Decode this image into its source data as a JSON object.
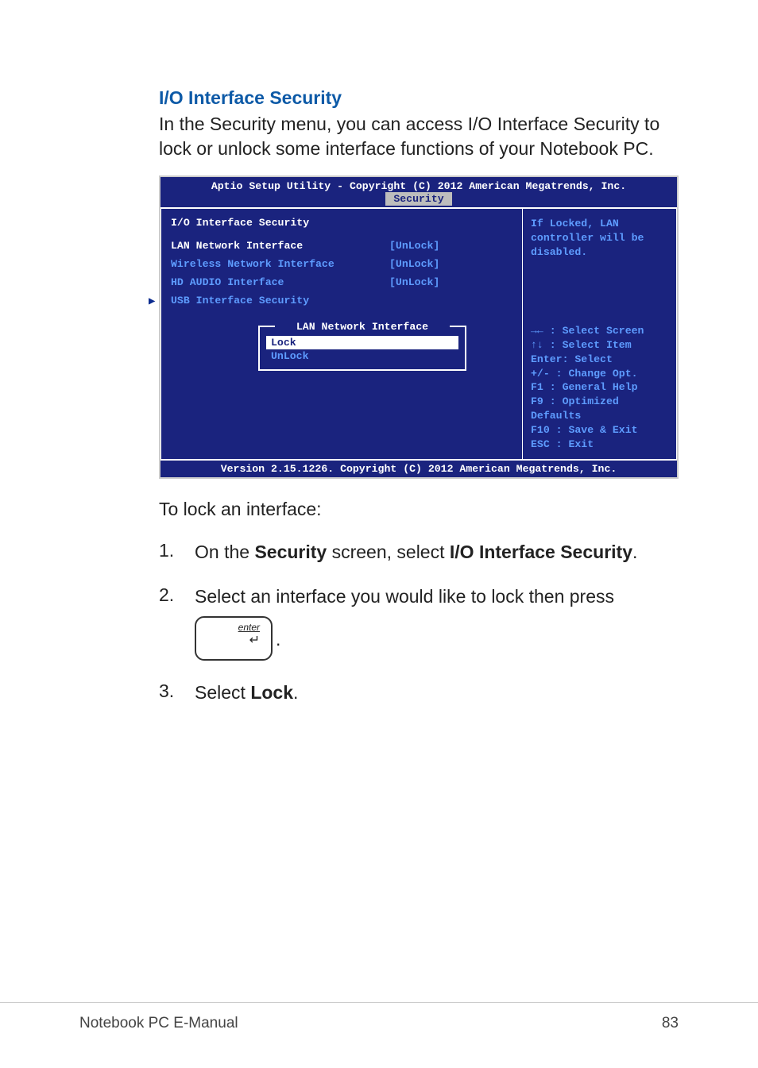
{
  "heading": "I/O Interface Security",
  "intro": "In the Security menu, you can access I/O Interface Security to lock or unlock some interface functions of your Notebook PC.",
  "bios": {
    "header": "Aptio Setup Utility - Copyright (C) 2012 American Megatrends, Inc.",
    "tab": "Security",
    "section_title": "I/O Interface Security",
    "rows": [
      {
        "label": "LAN Network Interface",
        "value": "[UnLock]"
      },
      {
        "label": "Wireless Network Interface",
        "value": "[UnLock]"
      },
      {
        "label": "HD AUDIO Interface",
        "value": "[UnLock]"
      }
    ],
    "submenu": "USB Interface Security",
    "popup": {
      "title": "LAN Network Interface",
      "options": [
        "Lock",
        "UnLock"
      ]
    },
    "help_text": "If Locked, LAN controller will be disabled.",
    "hotkeys": "→←  : Select Screen\n↑↓  : Select Item\nEnter: Select\n+/-  : Change Opt.\nF1   : General Help\nF9   : Optimized Defaults\nF10  : Save & Exit\nESC  : Exit",
    "footer": "Version 2.15.1226. Copyright (C) 2012 American Megatrends, Inc."
  },
  "post_bios": "To lock an interface:",
  "steps": [
    {
      "num": "1.",
      "text_parts": [
        "On the ",
        "Security",
        " screen, select ",
        "I/O Interface Security",
        "."
      ]
    },
    {
      "num": "2.",
      "text": "Select an interface you would like to lock then press",
      "has_key": true,
      "key_label": "enter"
    },
    {
      "num": "3.",
      "text_parts": [
        "Select ",
        "Lock",
        "."
      ]
    }
  ],
  "footer_left": "Notebook PC E-Manual",
  "footer_right": "83"
}
